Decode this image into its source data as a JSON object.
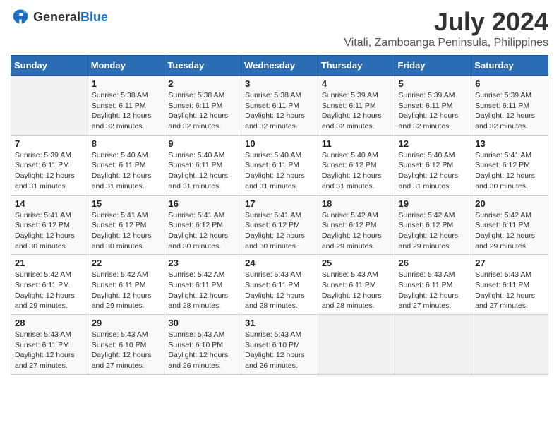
{
  "header": {
    "logo_general": "General",
    "logo_blue": "Blue",
    "title": "July 2024",
    "subtitle": "Vitali, Zamboanga Peninsula, Philippines"
  },
  "calendar": {
    "days_of_week": [
      "Sunday",
      "Monday",
      "Tuesday",
      "Wednesday",
      "Thursday",
      "Friday",
      "Saturday"
    ],
    "weeks": [
      [
        {
          "num": "",
          "sunrise": "",
          "sunset": "",
          "daylight": "",
          "empty": true
        },
        {
          "num": "1",
          "sunrise": "Sunrise: 5:38 AM",
          "sunset": "Sunset: 6:11 PM",
          "daylight": "Daylight: 12 hours and 32 minutes."
        },
        {
          "num": "2",
          "sunrise": "Sunrise: 5:38 AM",
          "sunset": "Sunset: 6:11 PM",
          "daylight": "Daylight: 12 hours and 32 minutes."
        },
        {
          "num": "3",
          "sunrise": "Sunrise: 5:38 AM",
          "sunset": "Sunset: 6:11 PM",
          "daylight": "Daylight: 12 hours and 32 minutes."
        },
        {
          "num": "4",
          "sunrise": "Sunrise: 5:39 AM",
          "sunset": "Sunset: 6:11 PM",
          "daylight": "Daylight: 12 hours and 32 minutes."
        },
        {
          "num": "5",
          "sunrise": "Sunrise: 5:39 AM",
          "sunset": "Sunset: 6:11 PM",
          "daylight": "Daylight: 12 hours and 32 minutes."
        },
        {
          "num": "6",
          "sunrise": "Sunrise: 5:39 AM",
          "sunset": "Sunset: 6:11 PM",
          "daylight": "Daylight: 12 hours and 32 minutes."
        }
      ],
      [
        {
          "num": "7",
          "sunrise": "Sunrise: 5:39 AM",
          "sunset": "Sunset: 6:11 PM",
          "daylight": "Daylight: 12 hours and 31 minutes."
        },
        {
          "num": "8",
          "sunrise": "Sunrise: 5:40 AM",
          "sunset": "Sunset: 6:11 PM",
          "daylight": "Daylight: 12 hours and 31 minutes."
        },
        {
          "num": "9",
          "sunrise": "Sunrise: 5:40 AM",
          "sunset": "Sunset: 6:11 PM",
          "daylight": "Daylight: 12 hours and 31 minutes."
        },
        {
          "num": "10",
          "sunrise": "Sunrise: 5:40 AM",
          "sunset": "Sunset: 6:11 PM",
          "daylight": "Daylight: 12 hours and 31 minutes."
        },
        {
          "num": "11",
          "sunrise": "Sunrise: 5:40 AM",
          "sunset": "Sunset: 6:12 PM",
          "daylight": "Daylight: 12 hours and 31 minutes."
        },
        {
          "num": "12",
          "sunrise": "Sunrise: 5:40 AM",
          "sunset": "Sunset: 6:12 PM",
          "daylight": "Daylight: 12 hours and 31 minutes."
        },
        {
          "num": "13",
          "sunrise": "Sunrise: 5:41 AM",
          "sunset": "Sunset: 6:12 PM",
          "daylight": "Daylight: 12 hours and 30 minutes."
        }
      ],
      [
        {
          "num": "14",
          "sunrise": "Sunrise: 5:41 AM",
          "sunset": "Sunset: 6:12 PM",
          "daylight": "Daylight: 12 hours and 30 minutes."
        },
        {
          "num": "15",
          "sunrise": "Sunrise: 5:41 AM",
          "sunset": "Sunset: 6:12 PM",
          "daylight": "Daylight: 12 hours and 30 minutes."
        },
        {
          "num": "16",
          "sunrise": "Sunrise: 5:41 AM",
          "sunset": "Sunset: 6:12 PM",
          "daylight": "Daylight: 12 hours and 30 minutes."
        },
        {
          "num": "17",
          "sunrise": "Sunrise: 5:41 AM",
          "sunset": "Sunset: 6:12 PM",
          "daylight": "Daylight: 12 hours and 30 minutes."
        },
        {
          "num": "18",
          "sunrise": "Sunrise: 5:42 AM",
          "sunset": "Sunset: 6:12 PM",
          "daylight": "Daylight: 12 hours and 29 minutes."
        },
        {
          "num": "19",
          "sunrise": "Sunrise: 5:42 AM",
          "sunset": "Sunset: 6:12 PM",
          "daylight": "Daylight: 12 hours and 29 minutes."
        },
        {
          "num": "20",
          "sunrise": "Sunrise: 5:42 AM",
          "sunset": "Sunset: 6:11 PM",
          "daylight": "Daylight: 12 hours and 29 minutes."
        }
      ],
      [
        {
          "num": "21",
          "sunrise": "Sunrise: 5:42 AM",
          "sunset": "Sunset: 6:11 PM",
          "daylight": "Daylight: 12 hours and 29 minutes."
        },
        {
          "num": "22",
          "sunrise": "Sunrise: 5:42 AM",
          "sunset": "Sunset: 6:11 PM",
          "daylight": "Daylight: 12 hours and 29 minutes."
        },
        {
          "num": "23",
          "sunrise": "Sunrise: 5:42 AM",
          "sunset": "Sunset: 6:11 PM",
          "daylight": "Daylight: 12 hours and 28 minutes."
        },
        {
          "num": "24",
          "sunrise": "Sunrise: 5:43 AM",
          "sunset": "Sunset: 6:11 PM",
          "daylight": "Daylight: 12 hours and 28 minutes."
        },
        {
          "num": "25",
          "sunrise": "Sunrise: 5:43 AM",
          "sunset": "Sunset: 6:11 PM",
          "daylight": "Daylight: 12 hours and 28 minutes."
        },
        {
          "num": "26",
          "sunrise": "Sunrise: 5:43 AM",
          "sunset": "Sunset: 6:11 PM",
          "daylight": "Daylight: 12 hours and 27 minutes."
        },
        {
          "num": "27",
          "sunrise": "Sunrise: 5:43 AM",
          "sunset": "Sunset: 6:11 PM",
          "daylight": "Daylight: 12 hours and 27 minutes."
        }
      ],
      [
        {
          "num": "28",
          "sunrise": "Sunrise: 5:43 AM",
          "sunset": "Sunset: 6:11 PM",
          "daylight": "Daylight: 12 hours and 27 minutes."
        },
        {
          "num": "29",
          "sunrise": "Sunrise: 5:43 AM",
          "sunset": "Sunset: 6:10 PM",
          "daylight": "Daylight: 12 hours and 27 minutes."
        },
        {
          "num": "30",
          "sunrise": "Sunrise: 5:43 AM",
          "sunset": "Sunset: 6:10 PM",
          "daylight": "Daylight: 12 hours and 26 minutes."
        },
        {
          "num": "31",
          "sunrise": "Sunrise: 5:43 AM",
          "sunset": "Sunset: 6:10 PM",
          "daylight": "Daylight: 12 hours and 26 minutes."
        },
        {
          "num": "",
          "sunrise": "",
          "sunset": "",
          "daylight": "",
          "empty": true
        },
        {
          "num": "",
          "sunrise": "",
          "sunset": "",
          "daylight": "",
          "empty": true
        },
        {
          "num": "",
          "sunrise": "",
          "sunset": "",
          "daylight": "",
          "empty": true
        }
      ]
    ]
  }
}
